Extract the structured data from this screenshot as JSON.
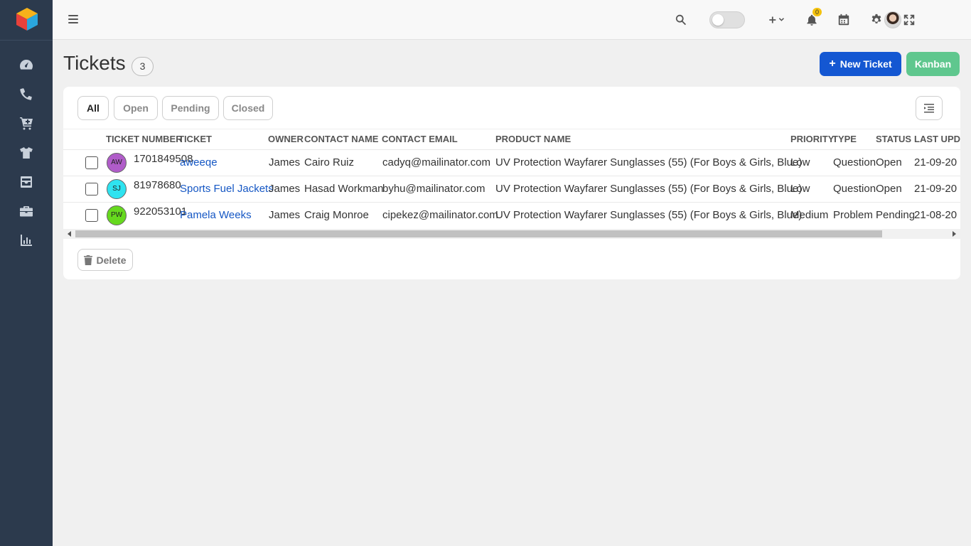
{
  "sidebar": {
    "logo": "cube-logo",
    "items": [
      {
        "icon": "dashboard-icon"
      },
      {
        "icon": "phone-icon"
      },
      {
        "icon": "cart-icon"
      },
      {
        "icon": "tshirt-icon"
      },
      {
        "icon": "inbox-icon"
      },
      {
        "icon": "briefcase-icon"
      },
      {
        "icon": "chart-icon"
      }
    ]
  },
  "topbar": {
    "notification_count": "0"
  },
  "page": {
    "title": "Tickets",
    "count": "3",
    "new_ticket_label": "New Ticket",
    "kanban_label": "Kanban"
  },
  "filters": [
    "All",
    "Open",
    "Pending",
    "Closed"
  ],
  "table": {
    "columns": [
      "TICKET NUMBER",
      "TICKET",
      "OWNER",
      "CONTACT NAME",
      "CONTACT EMAIL",
      "PRODUCT NAME",
      "PRIORITY",
      "TYPE",
      "STATUS",
      "LAST UPDA"
    ],
    "rows": [
      {
        "avatar": "AW",
        "avatar_color": "#b05cc9",
        "ticket_number": "1701849508",
        "ticket": "aweeqe",
        "owner": "James",
        "contact_name": "Cairo Ruiz",
        "contact_email": "cadyq@mailinator.com",
        "product_name": "UV Protection Wayfarer Sunglasses (55) (For Boys & Girls, Blue)",
        "priority": "Low",
        "type": "Question",
        "status": "Open",
        "last_updated": "21-09-20"
      },
      {
        "avatar": "SJ",
        "avatar_color": "#2ee3f0",
        "ticket_number": "81978680",
        "ticket": "Sports Fuel Jackets",
        "owner": "James",
        "contact_name": "Hasad Workman",
        "contact_email": "byhu@mailinator.com",
        "product_name": "UV Protection Wayfarer Sunglasses (55) (For Boys & Girls, Blue)",
        "priority": "Low",
        "type": "Question",
        "status": "Open",
        "last_updated": "21-09-20"
      },
      {
        "avatar": "PW",
        "avatar_color": "#66d91e",
        "ticket_number": "922053101",
        "ticket": "Pamela Weeks",
        "owner": "James",
        "contact_name": "Craig Monroe",
        "contact_email": "cipekez@mailinator.com",
        "product_name": "UV Protection Wayfarer Sunglasses (55) (For Boys & Girls, Blue)",
        "priority": "Medium",
        "type": "Problem",
        "status": "Pending",
        "last_updated": "21-08-20"
      }
    ]
  },
  "actions": {
    "delete_label": "Delete"
  },
  "colors": {
    "sidebar_bg": "#2c3a4d",
    "primary": "#1457d2",
    "kanban": "#5fc78e",
    "link": "#1557c4"
  }
}
